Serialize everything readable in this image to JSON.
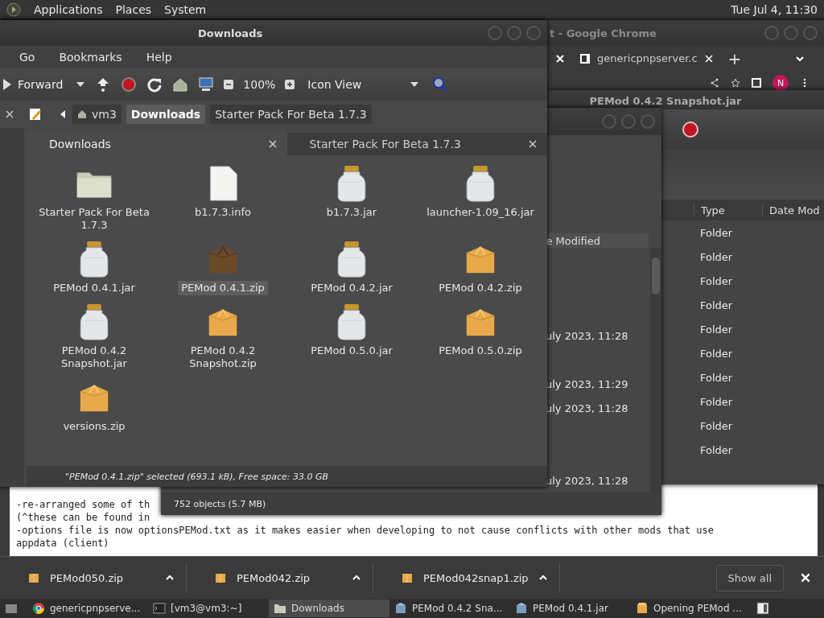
{
  "top_panel": {
    "menus": [
      "Applications",
      "Places",
      "System"
    ],
    "clock": "Tue Jul 4, 11:30"
  },
  "browser_window": {
    "title": "t - Google Chrome",
    "tabs": [
      {
        "label": "genericpnpserver.c",
        "selected": false
      }
    ],
    "new_tab": "+",
    "profile": "N",
    "document_lines": [
      "-re-arranged some of th",
      "(^these can be found in",
      "-options file is now optionsPEMod.txt as it makes easier when developing to not cause conflicts with other mods that use",
      "appdata (client)"
    ],
    "downloads": [
      "PEMod050.zip",
      "PEMod042.zip",
      "PEMod042snap1.zip"
    ],
    "show_all": "Show all"
  },
  "snapshot_window": {
    "title": "PEMod 0.4.2 Snapshot.jar",
    "columns": [
      "Type",
      "Date Mod"
    ],
    "rows": [
      {
        "type": "Folder"
      },
      {
        "type": "Folder"
      },
      {
        "type": "Folder"
      },
      {
        "type": "Folder"
      },
      {
        "type": "Folder"
      },
      {
        "type": "Folder"
      },
      {
        "type": "Folder"
      },
      {
        "type": "Folder"
      },
      {
        "type": "Folder"
      },
      {
        "type": "Folder"
      }
    ]
  },
  "archive_window": {
    "column": "e Modified",
    "rows": [
      {},
      {},
      {},
      {
        "date": "uly 2023, 11:28"
      },
      {},
      {
        "date": "uly 2023, 11:29"
      },
      {
        "date": "uly 2023, 11:28"
      },
      {},
      {},
      {
        "date": "uly 2023, 11:28"
      }
    ],
    "status": "752 objects (5.7 MB)"
  },
  "file_manager": {
    "title": "Downloads",
    "menus": [
      "Go",
      "Bookmarks",
      "Help"
    ],
    "toolbar": {
      "forward": "Forward",
      "zoom": "100%",
      "view": "Icon View"
    },
    "path": [
      {
        "label": "vm3",
        "selected": false,
        "kind": "home"
      },
      {
        "label": "Downloads",
        "selected": true,
        "kind": "folder"
      },
      {
        "label": "Starter Pack For Beta 1.7.3",
        "selected": false,
        "kind": "folder"
      }
    ],
    "panes": [
      {
        "label": "Downloads",
        "selected": true
      },
      {
        "label": "Starter Pack For Beta 1.7.3",
        "selected": false
      }
    ],
    "items": [
      {
        "name": "Starter Pack For Beta 1.7.3",
        "kind": "folder",
        "selected": false
      },
      {
        "name": "b1.7.3.info",
        "kind": "file",
        "selected": false
      },
      {
        "name": "b1.7.3.jar",
        "kind": "jar",
        "selected": false
      },
      {
        "name": "launcher-1.09_16.jar",
        "kind": "jar",
        "selected": false
      },
      {
        "name": "PEMod 0.4.1.jar",
        "kind": "jar",
        "selected": false
      },
      {
        "name": "PEMod 0.4.1.zip",
        "kind": "zip",
        "selected": true
      },
      {
        "name": "PEMod 0.4.2.jar",
        "kind": "jar",
        "selected": false
      },
      {
        "name": "PEMod 0.4.2.zip",
        "kind": "zip",
        "selected": false
      },
      {
        "name": "PEMod 0.4.2 Snapshot.jar",
        "kind": "jar",
        "selected": false
      },
      {
        "name": "PEMod 0.4.2 Snapshot.zip",
        "kind": "zip",
        "selected": false
      },
      {
        "name": "PEMod 0.5.0.jar",
        "kind": "jar",
        "selected": false
      },
      {
        "name": "PEMod 0.5.0.zip",
        "kind": "zip",
        "selected": false
      },
      {
        "name": "versions.zip",
        "kind": "zip",
        "selected": false
      }
    ],
    "status": "\"PEMod 0.4.1.zip\" selected (693.1 kB), Free space: 33.0 GB"
  },
  "taskbar": [
    {
      "label": "genericpnpserve...",
      "kind": "browser",
      "selected": false
    },
    {
      "label": "[vm3@vm3:~]",
      "kind": "terminal",
      "selected": false
    },
    {
      "label": "Downloads",
      "kind": "folder",
      "selected": true
    },
    {
      "label": "PEMod 0.4.2 Sna...",
      "kind": "archive",
      "selected": false
    },
    {
      "label": "PEMod 0.4.1.jar",
      "kind": "archive",
      "selected": false
    },
    {
      "label": "Opening PEMod ...",
      "kind": "zip",
      "selected": false
    }
  ]
}
